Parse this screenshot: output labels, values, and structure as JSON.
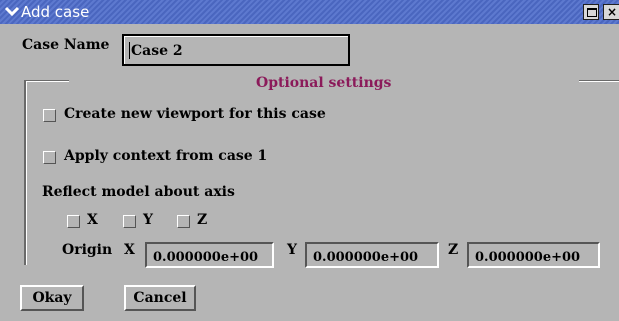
{
  "window": {
    "title": "Add case",
    "menu_icon": "chevron-down-icon",
    "maximize_icon": "maximize-icon",
    "close_icon": "close-icon",
    "close_glyph": "×"
  },
  "case_name": {
    "label": "Case Name",
    "value": "Case 2"
  },
  "optional_settings": {
    "title": "Optional settings",
    "create_viewport": {
      "label": "Create new viewport for this case",
      "checked": false
    },
    "apply_context": {
      "label": "Apply context from case 1",
      "checked": false
    },
    "reflect": {
      "label": "Reflect model about axis",
      "axes": [
        {
          "label": "X",
          "checked": false
        },
        {
          "label": "Y",
          "checked": false
        },
        {
          "label": "Z",
          "checked": false
        }
      ]
    },
    "origin": {
      "label": "Origin",
      "x": {
        "label": "X",
        "value": "0.000000e+00"
      },
      "y": {
        "label": "Y",
        "value": "0.000000e+00"
      },
      "z": {
        "label": "Z",
        "value": "0.000000e+00"
      }
    }
  },
  "buttons": {
    "okay": "Okay",
    "cancel": "Cancel"
  },
  "colors": {
    "titlebar": "#4a66bf",
    "background": "#b5b5b5",
    "legend_text": "#8b1a5a"
  }
}
